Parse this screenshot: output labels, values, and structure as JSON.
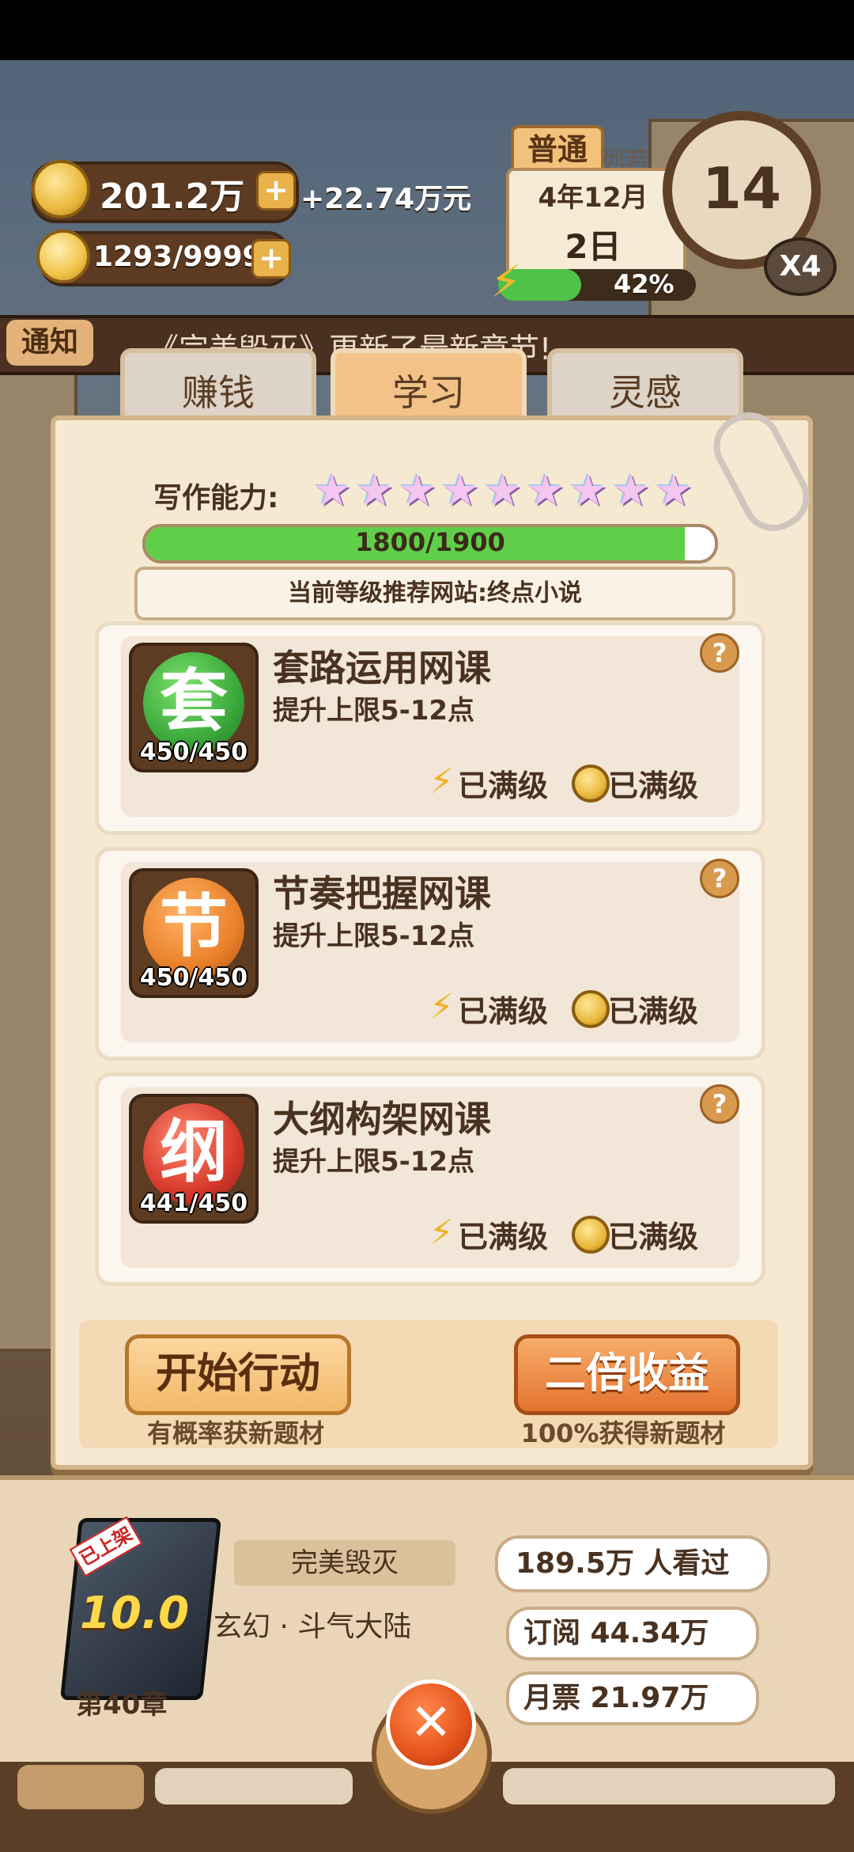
{
  "hud": {
    "coins": "201.2万",
    "income": "+22.74万元",
    "energy_count": "1293/9999",
    "difficulty": "普通",
    "hidden_tab": "列若",
    "date_line1": "4年12月",
    "date_line2": "2日",
    "energy_percent_text": "42%",
    "energy_percent": 0.42,
    "clock_value": "14",
    "speed": "X4",
    "plus_symbol": "+"
  },
  "notice": {
    "label": "通知",
    "text": "《完美毁灭》更新了最新章节!"
  },
  "tabs": [
    {
      "label": "赚钱",
      "active": false
    },
    {
      "label": "学习",
      "active": true
    },
    {
      "label": "灵感",
      "active": false
    }
  ],
  "skill": {
    "label": "写作能力:",
    "stars": 9,
    "progress_text": "1800/1900",
    "progress": 0.947,
    "recommend": "当前等级推荐网站:终点小说"
  },
  "courses": [
    {
      "icon_char": "套",
      "count": "450/450",
      "title": "套路运用网课",
      "desc": "提升上限5-12点",
      "color": "#3aa83a",
      "energy_status": "已满级",
      "coin_status": "已满级"
    },
    {
      "icon_char": "节",
      "count": "450/450",
      "title": "节奏把握网课",
      "desc": "提升上限5-12点",
      "color": "#e9802a",
      "energy_status": "已满级",
      "coin_status": "已满级"
    },
    {
      "icon_char": "纲",
      "count": "441/450",
      "title": "大纲构架网课",
      "desc": "提升上限5-12点",
      "color": "#d6392a",
      "energy_status": "已满级",
      "coin_status": "已满级"
    }
  ],
  "help_symbol": "?",
  "actions": {
    "start_label": "开始行动",
    "start_hint": "有概率获新题材",
    "double_label": "二倍收益",
    "double_hint": "100%获得新题材"
  },
  "book": {
    "title": "完美毁灭",
    "genre": "玄幻 · 斗气大陆",
    "chapter": "第40章",
    "rating": "10.0",
    "badge": "已上架",
    "views": "189.5万 人看过",
    "subscriptions": "订阅 44.34万",
    "monthly_votes": "月票 21.97万"
  },
  "close_symbol": "✕",
  "colors": {
    "progress_green": "#5fcf4a",
    "energy_green": "#4fc24a"
  }
}
